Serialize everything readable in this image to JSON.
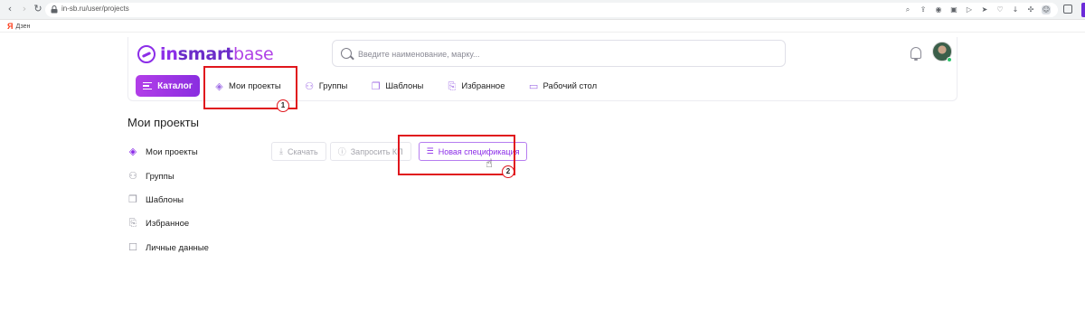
{
  "browser": {
    "url": "in-sb.ru/user/projects",
    "bookmark": "Дзен",
    "bookmark_logo": "Я",
    "icons": [
      "zoom-icon",
      "share-icon",
      "camera-icon",
      "screenshot-icon",
      "play-icon",
      "send-icon",
      "heart-icon",
      "download-icon",
      "puzzle-icon",
      "account-icon"
    ]
  },
  "header": {
    "logo": {
      "part1": "in",
      "part2": "smart",
      "part3": "base"
    },
    "search_placeholder": "Введите наименование, марку...",
    "nav": {
      "catalog": "Каталог",
      "items": [
        {
          "label": "Мои проекты",
          "icon": "layers-icon"
        },
        {
          "label": "Группы",
          "icon": "group-icon"
        },
        {
          "label": "Шаблоны",
          "icon": "templates-icon"
        },
        {
          "label": "Избранное",
          "icon": "bookmark-icon"
        },
        {
          "label": "Рабочий стол",
          "icon": "desktop-icon"
        }
      ]
    }
  },
  "page": {
    "title": "Мои проекты",
    "sidebar": [
      {
        "label": "Мои проекты",
        "icon": "layers-icon",
        "active": true
      },
      {
        "label": "Группы",
        "icon": "group-icon",
        "active": false
      },
      {
        "label": "Шаблоны",
        "icon": "templates-icon",
        "active": false
      },
      {
        "label": "Избранное",
        "icon": "bookmark-icon",
        "active": false
      },
      {
        "label": "Личные данные",
        "icon": "profile-icon",
        "active": false
      }
    ],
    "toolbar": {
      "download": "Скачать",
      "request": "Запросить КП",
      "new_spec": "Новая спецификация"
    }
  },
  "annotations": {
    "step1": "1",
    "step2": "2"
  },
  "colors": {
    "accent": "#8c2ee8",
    "annotation": "#e0161d"
  }
}
